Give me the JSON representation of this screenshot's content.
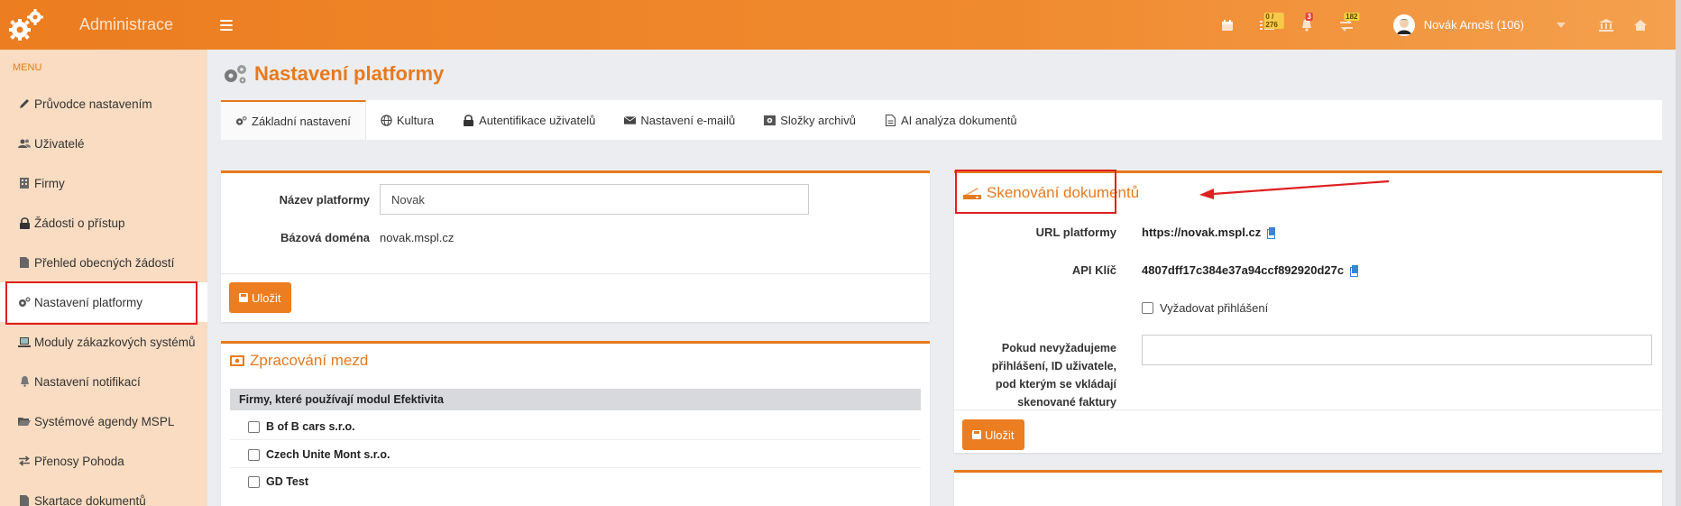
{
  "app": {
    "title": "Administrace",
    "brand_color": "#ec7d20"
  },
  "topbar": {
    "icons": [
      {
        "name": "calendar-icon"
      },
      {
        "name": "tasks-icon",
        "badge": "0 / 276"
      },
      {
        "name": "bell-icon",
        "badge": "3"
      },
      {
        "name": "transfers-icon",
        "badge": "182"
      }
    ],
    "user_name": "Novák Arnošt (106)"
  },
  "sidebar": {
    "caption": "MENU",
    "items": [
      {
        "label": "Průvodce nastavením",
        "icon": "pencil-icon"
      },
      {
        "label": "Uživatelé",
        "icon": "users-icon"
      },
      {
        "label": "Firmy",
        "icon": "building-icon"
      },
      {
        "label": "Žádosti o přístup",
        "icon": "lock-icon"
      },
      {
        "label": "Přehled obecných žádostí",
        "icon": "document-icon"
      },
      {
        "label": "Nastavení platformy",
        "icon": "gears-icon",
        "active": true
      },
      {
        "label": "Moduly zákazkových systémů",
        "icon": "laptop-icon"
      },
      {
        "label": "Nastavení notifikací",
        "icon": "bell-icon"
      },
      {
        "label": "Systémové agendy MSPL",
        "icon": "folder-open-icon"
      },
      {
        "label": "Přenosy Pohoda",
        "icon": "exchange-icon"
      },
      {
        "label": "Skartace dokumentů",
        "icon": "document-icon"
      }
    ]
  },
  "page": {
    "title": "Nastavení platformy"
  },
  "tabs": [
    {
      "label": "Základní nastavení",
      "icon": "gears-icon",
      "active": true
    },
    {
      "label": "Kultura",
      "icon": "globe-icon"
    },
    {
      "label": "Autentifikace uživatelů",
      "icon": "lock-icon"
    },
    {
      "label": "Nastavení e-mailů",
      "icon": "envelope-icon"
    },
    {
      "label": "Složky archivů",
      "icon": "archive-icon"
    },
    {
      "label": "AI analýza dokumentů",
      "icon": "file-icon"
    }
  ],
  "platform": {
    "name_label": "Název platformy",
    "name_value": "Novak",
    "domain_label": "Bázová doména",
    "domain_value": "novak.mspl.cz",
    "save_label": "Uložit"
  },
  "payroll": {
    "title": "Zpracování mezd",
    "firms_header": "Firmy, které používají modul Efektivita",
    "firms": [
      "B of B cars s.r.o.",
      "Czech Unite Mont s.r.o.",
      "GD Test"
    ]
  },
  "scanning": {
    "title": "Skenování dokumentů",
    "url_label": "URL platformy",
    "url_value": "https://novak.mspl.cz",
    "api_label": "API Klíč",
    "api_value": "4807dff17c384e37a94ccf892920d27c",
    "require_login_label": "Vyžadovat přihlášení",
    "user_id_label_lines": [
      "Pokud nevyžadujeme",
      "přihlášení, ID uživatele,",
      "pod kterým se vkládají",
      "skenované faktury"
    ],
    "user_id_value": "",
    "save_label": "Uložit"
  }
}
